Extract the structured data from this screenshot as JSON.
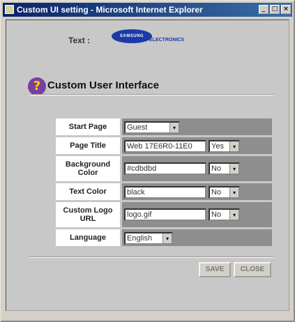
{
  "window": {
    "title": "Custom UI setting - Microsoft Internet Explorer",
    "buttons": {
      "minimize": "_",
      "maximize": "□",
      "close": "×"
    }
  },
  "header": {
    "text_label": "Text :",
    "logo": {
      "brand": "SAMSUNG",
      "subtitle": "ELECTRONICS"
    }
  },
  "section": {
    "icon": "?",
    "title": "Custom User Interface"
  },
  "form": {
    "rows": [
      {
        "label": "Start Page",
        "select_value": "Guest",
        "arrow": "▾"
      },
      {
        "label": "Page Title",
        "value": "Web 17E6R0-11E0",
        "toggle": "Yes",
        "arrow": "▾"
      },
      {
        "label": "Background Color",
        "value": "#cdbdbd",
        "toggle": "No",
        "arrow": "▾"
      },
      {
        "label": "Text Color",
        "value": "black",
        "toggle": "No",
        "arrow": "▾"
      },
      {
        "label": "Custom Logo URL",
        "value": "logo.gif",
        "toggle": "No",
        "arrow": "▾"
      },
      {
        "label": "Language",
        "select_value": "English",
        "arrow": "▾"
      }
    ]
  },
  "actions": {
    "save": "SAVE",
    "close": "CLOSE"
  }
}
